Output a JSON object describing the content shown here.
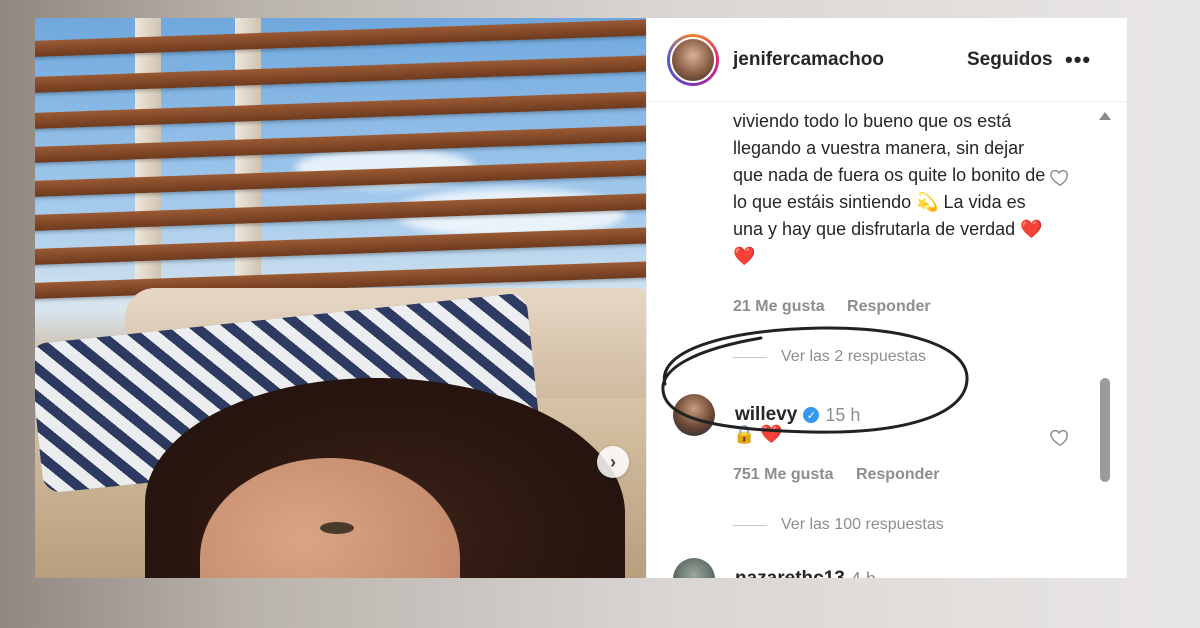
{
  "post": {
    "author_username": "jenifercamachoo",
    "follow_state": "Seguidos",
    "more_label": "•••",
    "next_label": "›"
  },
  "comments": [
    {
      "text": "viviendo todo lo bueno que os está llegando a vuestra manera, sin dejar que nada de fuera os quite lo bonito de lo que estáis sintiendo 💫 La vida es una y hay que disfrutarla de verdad ❤️ ❤️",
      "likes": "21 Me gusta",
      "reply_label": "Responder",
      "view_replies": "Ver las 2 respuestas"
    },
    {
      "username": "willevy",
      "verified": true,
      "time": "15 h",
      "text": "🔒 ❤️",
      "likes": "751 Me gusta",
      "reply_label": "Responder",
      "view_replies": "Ver las 100 respuestas"
    },
    {
      "username": "nazarethc13",
      "time": "4 h"
    }
  ],
  "icons": {
    "heart": "heart-outline-icon",
    "verified": "verified-badge-icon",
    "more": "more-options-icon",
    "next": "chevron-right-icon"
  },
  "colors": {
    "text_primary": "#262626",
    "text_secondary": "#8e8e8e",
    "verified_blue": "#3897f0",
    "heart_red": "#e0245e"
  }
}
